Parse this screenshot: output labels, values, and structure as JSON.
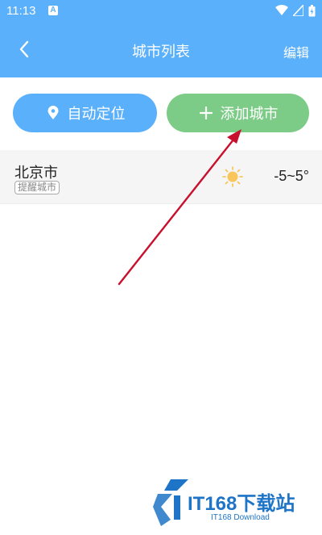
{
  "status_bar": {
    "time": "11:13",
    "notification_letter": "A"
  },
  "header": {
    "title": "城市列表",
    "edit_label": "编辑",
    "back_icon": "chevron-left-icon"
  },
  "actions": {
    "locate_label": "自动定位",
    "locate_icon": "location-pin-icon",
    "add_label": "添加城市",
    "add_icon": "plus-icon"
  },
  "cities": [
    {
      "name": "北京市",
      "badge": "提醒城市",
      "weather_icon": "sun-icon",
      "temperature": "-5~5°"
    }
  ],
  "watermark": {
    "text": "IT168下载站",
    "subtext": "IT168 Download"
  },
  "colors": {
    "header_bg": "#5AB0FA",
    "locate_button": "#5AB0FA",
    "add_button": "#7CCB86",
    "annotation_arrow": "#C8102E",
    "watermark_blue": "#1E74C6"
  }
}
